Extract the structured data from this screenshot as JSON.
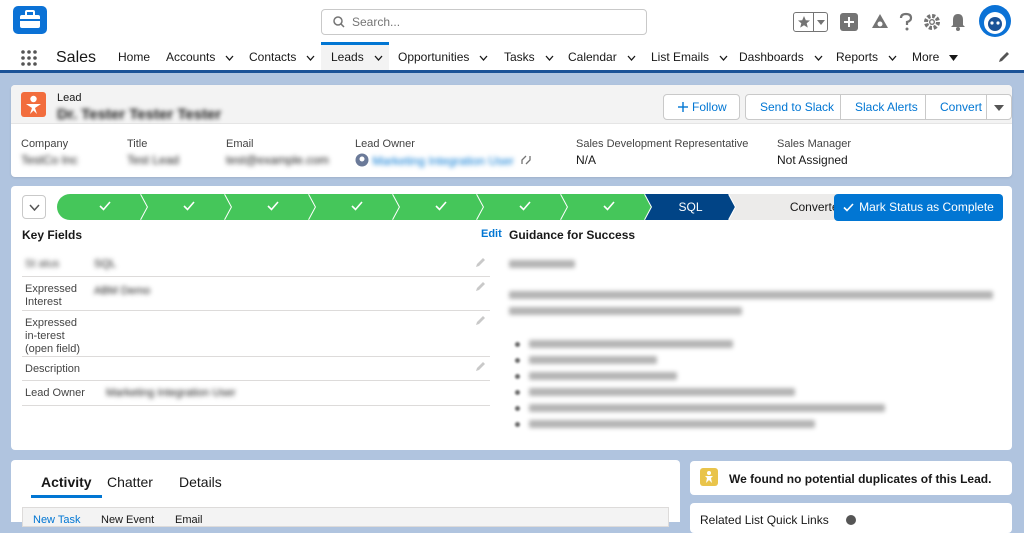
{
  "topbar": {
    "search_placeholder": "Search...",
    "icons": [
      "favorites-star-icon",
      "add-icon",
      "trailhead-icon",
      "help-icon",
      "setup-gear-icon",
      "notifications-bell-icon",
      "user-avatar"
    ]
  },
  "nav": {
    "app_name": "Sales",
    "items": [
      {
        "label": "Home",
        "has_menu": false
      },
      {
        "label": "Accounts",
        "has_menu": true
      },
      {
        "label": "Contacts",
        "has_menu": true
      },
      {
        "label": "Leads",
        "has_menu": true,
        "active": true
      },
      {
        "label": "Opportunities",
        "has_menu": true
      },
      {
        "label": "Tasks",
        "has_menu": true
      },
      {
        "label": "Calendar",
        "has_menu": true
      },
      {
        "label": "List Emails",
        "has_menu": true
      },
      {
        "label": "Dashboards",
        "has_menu": true
      },
      {
        "label": "Reports",
        "has_menu": true
      },
      {
        "label": "More",
        "has_menu": true
      }
    ]
  },
  "record": {
    "object_type": "Lead",
    "name": "Dr. Tester Tester Tester",
    "actions": [
      "Follow",
      "Send to Slack",
      "Slack Alerts",
      "Convert"
    ],
    "fields": [
      {
        "label": "Company",
        "value": "TestCo Inc"
      },
      {
        "label": "Title",
        "value": "Test Lead"
      },
      {
        "label": "Email",
        "value": "test@example.com"
      },
      {
        "label": "Lead Owner",
        "value": "Marketing Integration User"
      },
      {
        "label": "Sales Development Representative",
        "value": "N/A"
      },
      {
        "label": "Sales Manager",
        "value": "Not Assigned"
      }
    ]
  },
  "path": {
    "stages": [
      {
        "label": "",
        "status": "complete"
      },
      {
        "label": "",
        "status": "complete"
      },
      {
        "label": "",
        "status": "complete"
      },
      {
        "label": "",
        "status": "complete"
      },
      {
        "label": "",
        "status": "complete"
      },
      {
        "label": "",
        "status": "complete"
      },
      {
        "label": "",
        "status": "complete"
      },
      {
        "label": "SQL",
        "status": "current"
      },
      {
        "label": "Converted",
        "status": "incomplete"
      }
    ],
    "mark_button": "Mark Status as Complete"
  },
  "key_fields": {
    "title": "Key Fields",
    "edit_label": "Edit",
    "rows": [
      {
        "label": "St atus",
        "value": "SQL"
      },
      {
        "label": "Expressed Interest",
        "value": "ABM Demo"
      },
      {
        "label": "Expressed in-terest (open field)",
        "value": ""
      },
      {
        "label": "Description",
        "value": ""
      },
      {
        "label": "Lead Owner",
        "value": "Marketing Integration User"
      }
    ]
  },
  "guidance": {
    "title": "Guidance for Success"
  },
  "activity": {
    "tabs": [
      "Activity",
      "Chatter",
      "Details"
    ],
    "subtabs": [
      "New Task",
      "New Event",
      "Email"
    ]
  },
  "duplicates": {
    "message": "We found no potential duplicates of this Lead."
  },
  "related": {
    "title": "Related List Quick Links"
  },
  "colors": {
    "brand": "#0176d3",
    "path_complete": "#45c65a",
    "path_current": "#014486",
    "lead_icon": "#f26d3d"
  }
}
